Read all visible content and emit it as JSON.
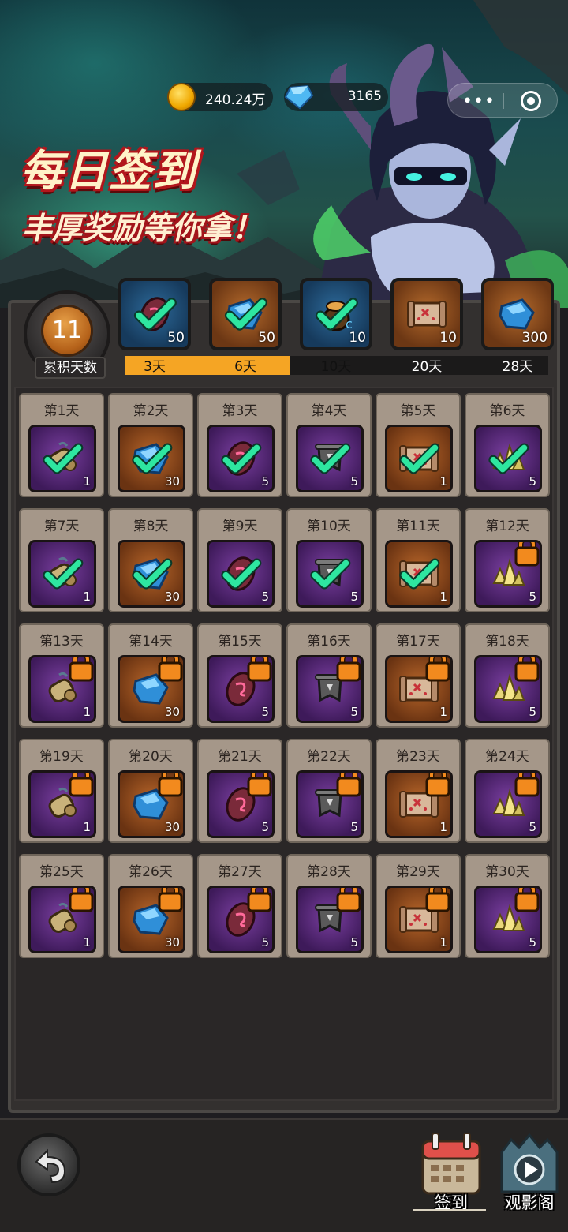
{
  "resources": {
    "coins": "240.24万",
    "gems": "3165"
  },
  "banner": {
    "title": "每日签到",
    "subtitle": "丰厚奖励等你拿！"
  },
  "accumulated": {
    "days": "11",
    "label": "累积天数",
    "progress_fraction": 0.39
  },
  "milestones": [
    {
      "day": "3天",
      "qty": "50",
      "color": "blue",
      "icon": "rune-stone-icon",
      "claimed": true
    },
    {
      "day": "6天",
      "qty": "50",
      "color": "brown",
      "icon": "blue-gem-icon",
      "claimed": true
    },
    {
      "day": "10天",
      "qty": "10",
      "color": "blue",
      "icon": "treasure-bag-icon",
      "claimed": true
    },
    {
      "day": "20天",
      "qty": "10",
      "color": "brown",
      "icon": "treasure-map-icon",
      "claimed": false
    },
    {
      "day": "28天",
      "qty": "300",
      "color": "brown",
      "icon": "blue-gem-icon",
      "claimed": false
    }
  ],
  "rewards": [
    {
      "day": "第1天",
      "qty": "1",
      "color": "purple",
      "icon": "scroll-bundle-icon",
      "state": "claimed"
    },
    {
      "day": "第2天",
      "qty": "30",
      "color": "brown",
      "icon": "blue-gem-icon",
      "state": "claimed"
    },
    {
      "day": "第3天",
      "qty": "5",
      "color": "purple",
      "icon": "rune-stone-icon",
      "state": "claimed"
    },
    {
      "day": "第4天",
      "qty": "5",
      "color": "purple",
      "icon": "banner-scroll-icon",
      "state": "claimed"
    },
    {
      "day": "第5天",
      "qty": "1",
      "color": "brown",
      "icon": "treasure-map-icon",
      "state": "claimed"
    },
    {
      "day": "第6天",
      "qty": "5",
      "color": "purple",
      "icon": "gold-crystal-icon",
      "state": "claimed"
    },
    {
      "day": "第7天",
      "qty": "1",
      "color": "purple",
      "icon": "scroll-bundle-icon",
      "state": "claimed"
    },
    {
      "day": "第8天",
      "qty": "30",
      "color": "brown",
      "icon": "blue-gem-icon",
      "state": "claimed"
    },
    {
      "day": "第9天",
      "qty": "5",
      "color": "purple",
      "icon": "rune-stone-icon",
      "state": "claimed"
    },
    {
      "day": "第10天",
      "qty": "5",
      "color": "purple",
      "icon": "banner-scroll-icon",
      "state": "claimed"
    },
    {
      "day": "第11天",
      "qty": "1",
      "color": "brown",
      "icon": "treasure-map-icon",
      "state": "claimed"
    },
    {
      "day": "第12天",
      "qty": "5",
      "color": "purple",
      "icon": "gold-crystal-icon",
      "state": "locked"
    },
    {
      "day": "第13天",
      "qty": "1",
      "color": "purple",
      "icon": "scroll-bundle-icon",
      "state": "locked"
    },
    {
      "day": "第14天",
      "qty": "30",
      "color": "brown",
      "icon": "blue-gem-icon",
      "state": "locked"
    },
    {
      "day": "第15天",
      "qty": "5",
      "color": "purple",
      "icon": "rune-stone-icon",
      "state": "locked"
    },
    {
      "day": "第16天",
      "qty": "5",
      "color": "purple",
      "icon": "banner-scroll-icon",
      "state": "locked"
    },
    {
      "day": "第17天",
      "qty": "1",
      "color": "brown",
      "icon": "treasure-map-icon",
      "state": "locked"
    },
    {
      "day": "第18天",
      "qty": "5",
      "color": "purple",
      "icon": "gold-crystal-icon",
      "state": "locked"
    },
    {
      "day": "第19天",
      "qty": "1",
      "color": "purple",
      "icon": "scroll-bundle-icon",
      "state": "locked"
    },
    {
      "day": "第20天",
      "qty": "30",
      "color": "brown",
      "icon": "blue-gem-icon",
      "state": "locked"
    },
    {
      "day": "第21天",
      "qty": "5",
      "color": "purple",
      "icon": "rune-stone-icon",
      "state": "locked"
    },
    {
      "day": "第22天",
      "qty": "5",
      "color": "purple",
      "icon": "banner-scroll-icon",
      "state": "locked"
    },
    {
      "day": "第23天",
      "qty": "1",
      "color": "brown",
      "icon": "treasure-map-icon",
      "state": "locked"
    },
    {
      "day": "第24天",
      "qty": "5",
      "color": "purple",
      "icon": "gold-crystal-icon",
      "state": "locked"
    },
    {
      "day": "第25天",
      "qty": "1",
      "color": "purple",
      "icon": "scroll-bundle-icon",
      "state": "locked"
    },
    {
      "day": "第26天",
      "qty": "30",
      "color": "brown",
      "icon": "blue-gem-icon",
      "state": "locked"
    },
    {
      "day": "第27天",
      "qty": "5",
      "color": "purple",
      "icon": "rune-stone-icon",
      "state": "locked"
    },
    {
      "day": "第28天",
      "qty": "5",
      "color": "purple",
      "icon": "banner-scroll-icon",
      "state": "locked"
    },
    {
      "day": "第29天",
      "qty": "1",
      "color": "brown",
      "icon": "treasure-map-icon",
      "state": "locked"
    },
    {
      "day": "第30天",
      "qty": "5",
      "color": "purple",
      "icon": "gold-crystal-icon",
      "state": "locked"
    }
  ],
  "bottom_nav": {
    "sign_in": "签到",
    "video_hall": "观影阁"
  },
  "colors": {
    "progress": "#f5a524",
    "check": "#2ee6a0",
    "lock": "#f28a1e"
  }
}
